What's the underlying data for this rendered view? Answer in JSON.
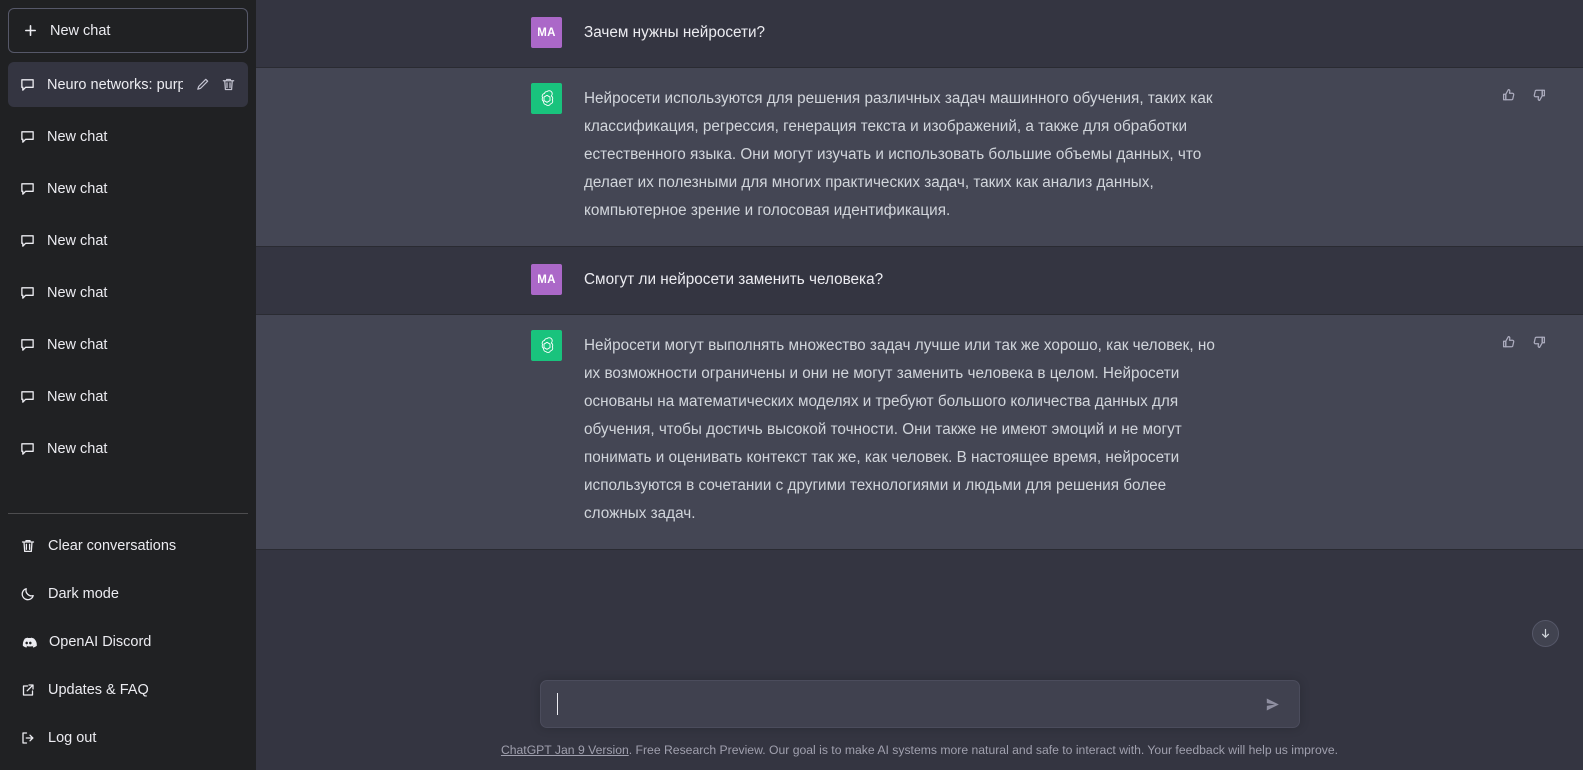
{
  "theme": {
    "sidebar_bg": "#202123",
    "user_row_bg": "#343541",
    "assistant_row_bg": "#444654",
    "user_avatar_color": "#ab68c8",
    "assistant_avatar_color": "#19c37d",
    "text_color": "#d1d5db"
  },
  "sidebar": {
    "new_chat_label": "New chat",
    "chats": [
      {
        "label": "Neuro networks: purpos",
        "active": true
      },
      {
        "label": "New chat",
        "active": false
      },
      {
        "label": "New chat",
        "active": false
      },
      {
        "label": "New chat",
        "active": false
      },
      {
        "label": "New chat",
        "active": false
      },
      {
        "label": "New chat",
        "active": false
      },
      {
        "label": "New chat",
        "active": false
      },
      {
        "label": "New chat",
        "active": false
      }
    ],
    "footer": [
      {
        "label": "Clear conversations",
        "icon": "trash-icon"
      },
      {
        "label": "Dark mode",
        "icon": "moon-icon"
      },
      {
        "label": "OpenAI Discord",
        "icon": "discord-icon"
      },
      {
        "label": "Updates & FAQ",
        "icon": "external-link-icon"
      },
      {
        "label": "Log out",
        "icon": "logout-icon"
      }
    ]
  },
  "conversation": {
    "messages": [
      {
        "role": "user",
        "avatar_initials": "MA",
        "text": "Зачем нужны нейросети?"
      },
      {
        "role": "assistant",
        "text": "Нейросети используются для решения различных задач машинного обучения, таких как классификация, регрессия, генерация текста и изображений, а также для обработки естественного языка. Они могут изучать и использовать большие объемы данных, что делает их полезными для многих практических задач, таких как анализ данных, компьютерное зрение и голосовая идентификация."
      },
      {
        "role": "user",
        "avatar_initials": "MA",
        "text": "Смогут ли нейросети заменить человека?"
      },
      {
        "role": "assistant",
        "text": "Нейросети могут выполнять множество задач лучше или так же хорошо, как человек, но их возможности ограничены и они не могут заменить человека в целом. Нейросети основаны на математических моделях и требуют большого количества данных для обучения, чтобы достичь высокой точности. Они также не имеют эмоций и не могут понимать и оценивать контекст так же, как человек. В настоящее время, нейросети используются в сочетании с другими технологиями и людьми для решения более сложных задач."
      }
    ]
  },
  "composer": {
    "value": "",
    "placeholder": "",
    "send_label": "send-icon"
  },
  "footer": {
    "version_link": "ChatGPT Jan 9 Version",
    "disclaimer": ". Free Research Preview. Our goal is to make AI systems more natural and safe to interact with. Your feedback will help us improve."
  }
}
